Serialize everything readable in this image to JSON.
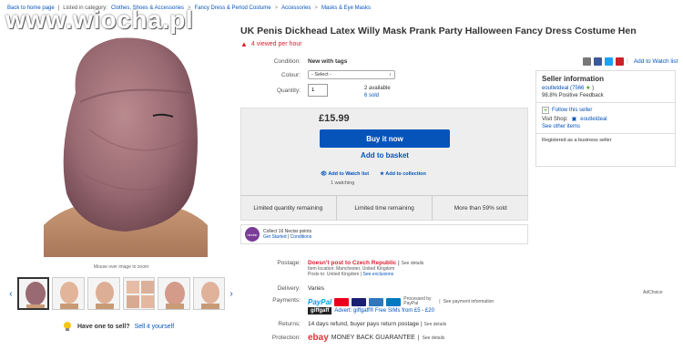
{
  "watermark": "www.wiocha.pl",
  "breadcrumb": {
    "back": "Back to home page",
    "listed_in": "Listed in category:",
    "items": [
      "Clothes, Shoes & Accessories",
      "Fancy Dress & Period Costume",
      "Accessories",
      "Masks & Eye Masks"
    ],
    "sep": ">"
  },
  "title": "UK Penis Dickhead Latex Willy Mask Prank Party Halloween Fancy Dress Costume Hen",
  "viewed": "4 viewed per hour",
  "condition": {
    "label": "Condition:",
    "value": "New with tags"
  },
  "color": {
    "label": "Colour:",
    "value": "- Select -"
  },
  "quantity": {
    "label": "Quantity:",
    "value": "1",
    "available": "2 available",
    "sold": "6 sold"
  },
  "share": {
    "watch": "Add to Watch list"
  },
  "buy": {
    "price": "£15.99",
    "buy_now": "Buy it now",
    "basket": "Add to basket",
    "watch_list": "Add to Watch list",
    "collection": "Add to collection",
    "watching": "1 watching"
  },
  "stats": [
    "Limited quantity remaining",
    "Limited time remaining",
    "More than 59% sold"
  ],
  "nectar": {
    "logo": "nectar",
    "line1": "Collect 16 Nectar points",
    "get_started": "Get Started",
    "conditions": "Conditions"
  },
  "zoom_caption": "Mouse over image to zoom",
  "have_one": {
    "text": "Have one to sell?",
    "link": "Sell it yourself"
  },
  "postage": {
    "label": "Postage:",
    "value": "Doesn't post to Czech Republic",
    "see": "See details",
    "location": "Item location:  Manchester, United Kingdom",
    "posts_to": "Posts to:  United Kingdom",
    "exclusions": "See exclusions"
  },
  "delivery": {
    "label": "Delivery:",
    "value": "Varies"
  },
  "payments": {
    "label": "Payments:",
    "paypal_a": "Pay",
    "paypal_b": "Pal",
    "processed": "Processed by PayPal",
    "see": "See payment information",
    "giff": "giffgaff",
    "advert": "Advert: giffgaff® Free SIMs from £5 - £20"
  },
  "returns": {
    "label": "Returns:",
    "value": "14 days refund, buyer pays return postage",
    "see": "See details"
  },
  "protection": {
    "label": "Protection:",
    "logo": "ebay",
    "value": "MONEY BACK GUARANTEE",
    "see": "See details"
  },
  "adchoice": "AdChoice",
  "seller": {
    "heading": "Seller information",
    "name": "eoutletdeal",
    "feedback_count": "(7566",
    "feedback_close": ")",
    "positive": "98.8% Positive Feedback",
    "follow": "Follow this seller",
    "visit_label": "Visit Shop:",
    "shop": "eoutletdeal",
    "see_items": "See other items",
    "business": "Registered as a business seller"
  },
  "colors": {
    "link": "#0654ba",
    "buy_button": "#0654ba",
    "alert": "#dd1e31"
  }
}
